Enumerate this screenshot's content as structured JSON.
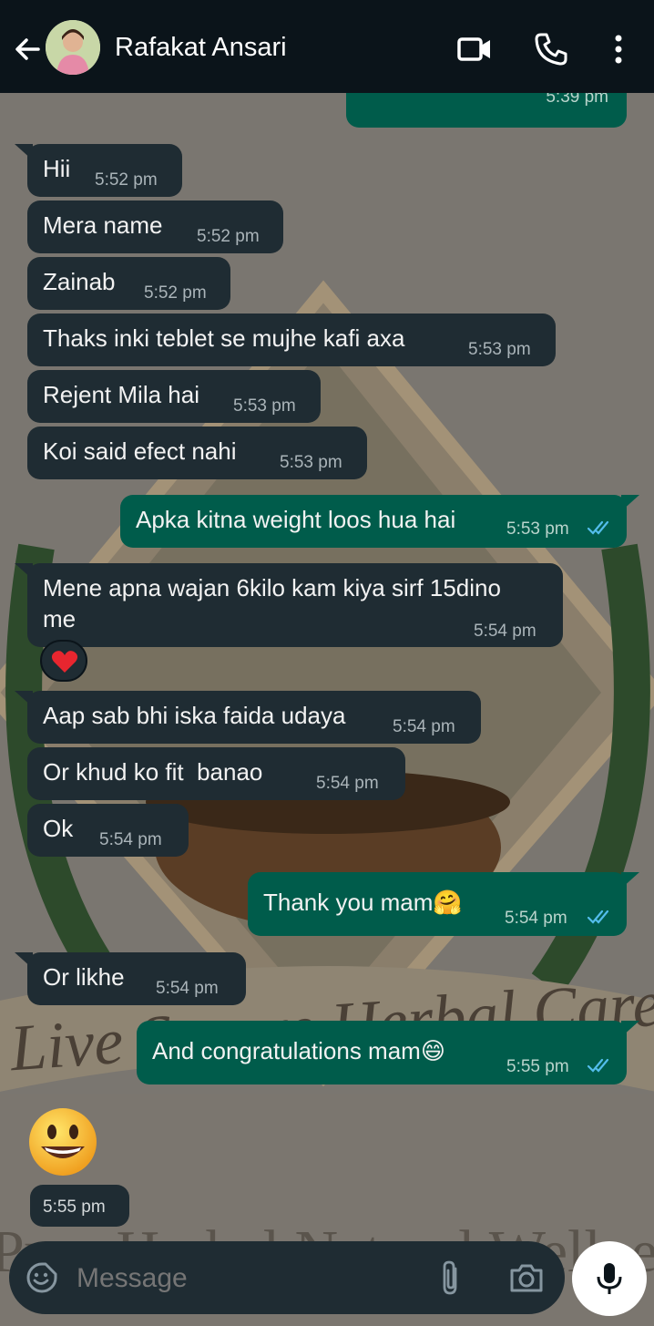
{
  "header": {
    "contact_name": "Rafakat Ansari"
  },
  "prev_message": {
    "time": "5:39 pm"
  },
  "messages": [
    {
      "dir": "in",
      "text": "Hii",
      "time": "5:52 pm"
    },
    {
      "dir": "in",
      "text": "Mera name",
      "time": "5:52 pm"
    },
    {
      "dir": "in",
      "text": "Zainab",
      "time": "5:52 pm"
    },
    {
      "dir": "in",
      "text": "Thaks inki teblet se mujhe kafi axa",
      "time": "5:53 pm"
    },
    {
      "dir": "in",
      "text": "Rejent Mila hai",
      "time": "5:53 pm"
    },
    {
      "dir": "in",
      "text": "Koi said efect nahi",
      "time": "5:53 pm"
    },
    {
      "dir": "out",
      "text": "Apka kitna weight loos hua hai",
      "time": "5:53 pm"
    },
    {
      "dir": "in",
      "text_line1": "Mene apna wajan 6kilo kam kiya sirf 15dino",
      "text_line2": "me",
      "time": "5:54 pm",
      "reaction": "❤️"
    },
    {
      "dir": "in",
      "text": "Aap sab bhi iska faida udaya",
      "time": "5:54 pm"
    },
    {
      "dir": "in",
      "text": "Or khud ko fit  banao",
      "time": "5:54 pm"
    },
    {
      "dir": "in",
      "text": "Ok",
      "time": "5:54 pm"
    },
    {
      "dir": "out",
      "text": "Thank you mam🤗",
      "time": "5:54 pm"
    },
    {
      "dir": "in",
      "text": "Or likhe",
      "time": "5:54 pm"
    },
    {
      "dir": "out",
      "text": "And congratulations mam😄",
      "time": "5:55 pm"
    },
    {
      "dir": "in",
      "sticker": "😃",
      "time": "5:55 pm"
    }
  ],
  "wallpaper": {
    "text_line1": "Live Secure Herbal Care",
    "text_line2": "Pure Herbal Natural Wellness"
  },
  "composer": {
    "placeholder": "Message"
  },
  "colors": {
    "header_bg": "#0b141a",
    "incoming_bubble": "#1f2c33",
    "outgoing_bubble": "#005c4b",
    "read_ticks": "#53bdeb"
  },
  "icons": [
    "back-arrow-icon",
    "video-call-icon",
    "phone-icon",
    "more-options-icon",
    "emoji-icon",
    "attach-icon",
    "camera-icon",
    "mic-icon"
  ]
}
